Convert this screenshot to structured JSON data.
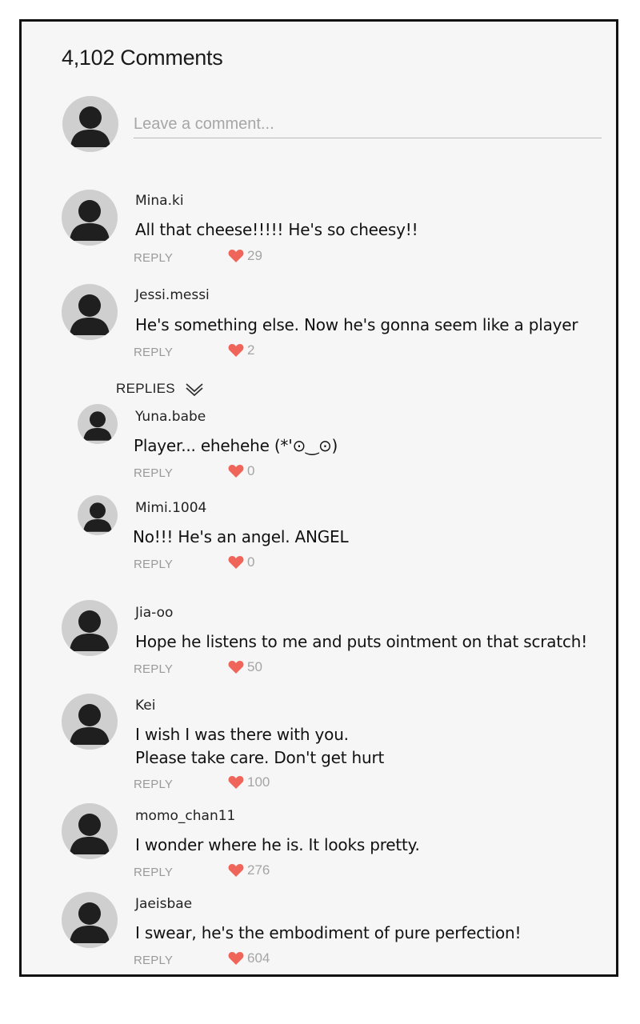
{
  "header": {
    "title": "4,102 Comments"
  },
  "compose": {
    "placeholder": "Leave a comment..."
  },
  "reply_label": "REPLY",
  "replies_toggle": {
    "label": "REPLIES",
    "icon": "double-chevron-down-icon"
  },
  "colors": {
    "heart": "#f0655a",
    "background": "#f5f6f5"
  },
  "comments": [
    {
      "user": "Mina.ki",
      "text": "All that cheese!!!!! He's so cheesy!!",
      "likes": "29"
    },
    {
      "user": "Jessi.messi",
      "text": "He's something else. Now he's gonna seem like a player",
      "likes": "2"
    }
  ],
  "replies": [
    {
      "user": "Yuna.babe",
      "text": "Player... ehehehe (*'⊙‿⊙)",
      "likes": "0"
    },
    {
      "user": "Mimi.1004",
      "text": "No!!! He's an angel. ANGEL",
      "likes": "0"
    }
  ],
  "more_comments": [
    {
      "user": "Jia-oo",
      "text": "Hope he listens to me and puts ointment on that scratch!",
      "likes": "50"
    },
    {
      "user": "Kei",
      "text_line1": "I wish I was there with you.",
      "text_line2": "Please take care. Don't get hurt",
      "likes": "100"
    },
    {
      "user": "momo_chan11",
      "text": "I wonder where he is. It looks pretty.",
      "likes": "276"
    },
    {
      "user": "Jaeisbae",
      "text": "I swear, he's the embodiment of pure perfection!",
      "likes": "604"
    }
  ]
}
